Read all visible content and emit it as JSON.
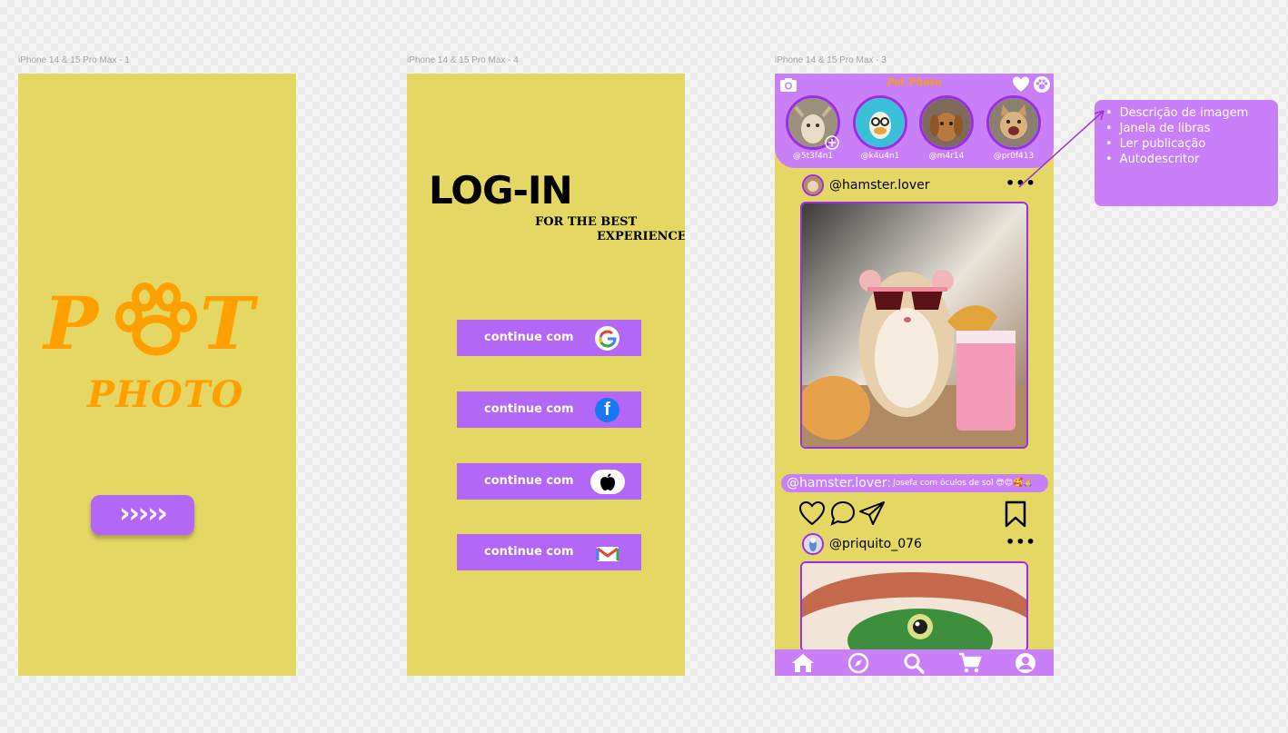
{
  "frames": {
    "splash": {
      "label": "iPhone 14 & 15 Pro Max - 1"
    },
    "login": {
      "label": "iPhone 14 & 15 Pro Max - 4"
    },
    "feed": {
      "label": "iPhone 14 & 15 Pro Max - 3"
    }
  },
  "splash": {
    "logo_left": "P",
    "logo_right": "T",
    "logo_sub": "PHOTO",
    "start_button": "›››››"
  },
  "login": {
    "title": "LOG-IN",
    "subtitle_line1": "FOR THE BEST",
    "subtitle_line2": "EXPERIENCE",
    "buttons": [
      {
        "label": "continue com",
        "provider_icon": "google-icon"
      },
      {
        "label": "continue com",
        "provider_icon": "facebook-icon"
      },
      {
        "label": "continue com",
        "provider_icon": "apple-icon"
      },
      {
        "label": "continue com",
        "provider_icon": "gmail-icon"
      }
    ]
  },
  "feed": {
    "app_title": "Pet Photo",
    "stories": [
      {
        "name": "@5t3f4n1"
      },
      {
        "name": "@k4u4n1"
      },
      {
        "name": "@m4r14"
      },
      {
        "name": "@pr0f413"
      }
    ],
    "posts": [
      {
        "user": "@hamster.lover",
        "more": "•••",
        "caption_user": "@hamster.lover:",
        "caption_text": "Josefa com óculos de sol 😎😍🥰🙏"
      },
      {
        "user": "@priquito_076",
        "more": "•••"
      }
    ],
    "nav": [
      "home-icon",
      "compass-icon",
      "search-icon",
      "cart-icon",
      "profile-icon"
    ]
  },
  "note": {
    "items": [
      "Descrição de imagem",
      "Janela de libras",
      "Ler publicação",
      "Autodescritor"
    ]
  },
  "colors": {
    "frame_bg": "#e5d764",
    "accent": "#c87ff7",
    "button": "#b367f6",
    "logo": "#ffa000"
  }
}
